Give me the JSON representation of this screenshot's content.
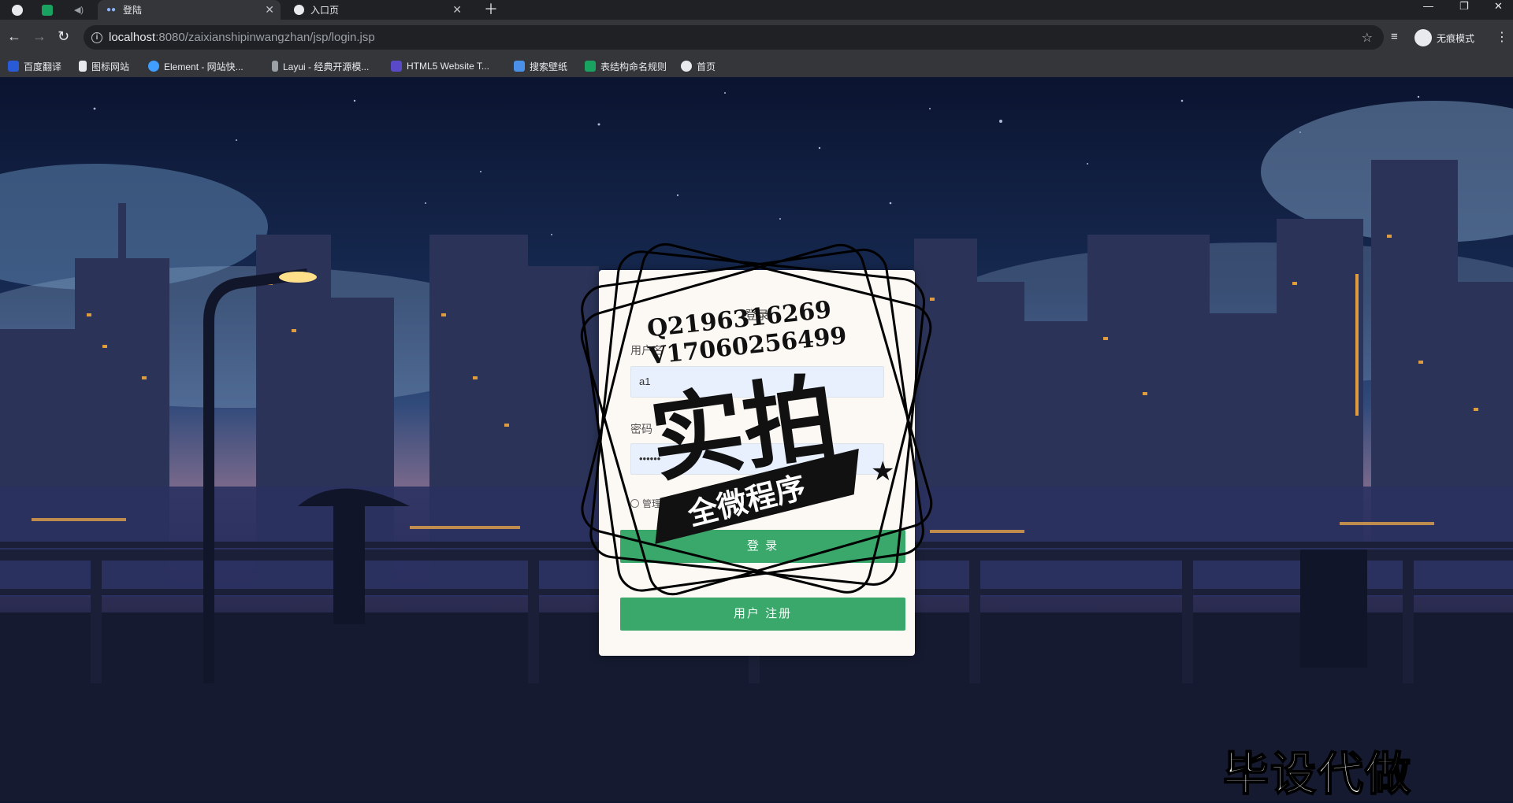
{
  "browser": {
    "tabs": [
      {
        "label": "登陆",
        "active": true
      },
      {
        "label": "入口页",
        "active": false
      }
    ],
    "url_host": "localhost",
    "url_path": ":8080/zaixianshipinwangzhan/jsp/login.jsp",
    "incognito_label": "无痕模式",
    "bookmarks": [
      {
        "label": "百度翻译",
        "color": "#2a5bd7"
      },
      {
        "label": "图标网站",
        "color": "#e8eaed"
      },
      {
        "label": "Element - 网站快...",
        "color": "#409eff"
      },
      {
        "label": "Layui - 经典开源模...",
        "color": "#9aa0a6"
      },
      {
        "label": "HTML5 Website T...",
        "color": "#5b4ac8"
      },
      {
        "label": "搜索壁纸",
        "color": "#4a8fe8"
      },
      {
        "label": "表结构命名规则",
        "color": "#1aa260"
      },
      {
        "label": "首页",
        "color": "#e8eaed"
      }
    ]
  },
  "login": {
    "title": "登录",
    "username_label": "用户名",
    "username_value": "a1",
    "password_label": "密码",
    "password_value": "••••••",
    "role_options": [
      "管理员",
      ""
    ],
    "login_button": "登 录",
    "register_button": "用户 注册"
  },
  "watermark": {
    "line1": "Q2196316269",
    "line2": "V17060256499",
    "big": "实拍",
    "ribbon": "全微程序",
    "corner": "毕设代做"
  }
}
